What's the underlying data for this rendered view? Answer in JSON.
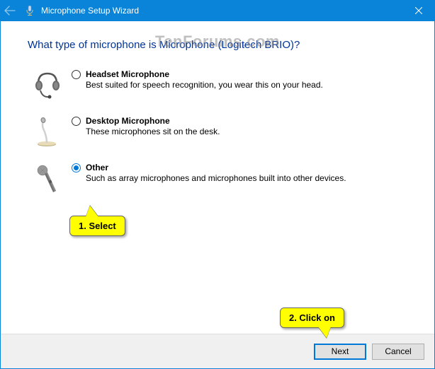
{
  "watermark": "TenForums.com",
  "titlebar": {
    "title": "Microphone Setup Wizard"
  },
  "heading": "What type of microphone is Microphone (Logitech BRIO)?",
  "options": [
    {
      "label": "Headset Microphone",
      "desc": "Best suited for speech recognition, you wear this on your head.",
      "selected": false
    },
    {
      "label": "Desktop Microphone",
      "desc": "These microphones sit on the desk.",
      "selected": false
    },
    {
      "label": "Other",
      "desc": "Such as array microphones and microphones built into other devices.",
      "selected": true
    }
  ],
  "callouts": {
    "select": "1. Select",
    "clickon": "2. Click on"
  },
  "footer": {
    "next": "Next",
    "cancel": "Cancel"
  }
}
